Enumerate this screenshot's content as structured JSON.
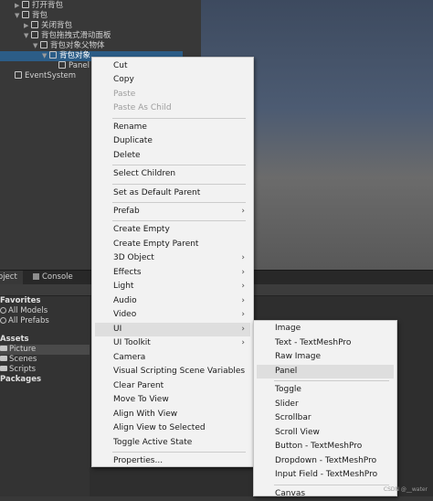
{
  "hierarchy": {
    "items": [
      {
        "label": "打开背包"
      },
      {
        "label": "背包"
      },
      {
        "label": "关闭背包"
      },
      {
        "label": "背包拖拽式滑动面板"
      },
      {
        "label": "背包对象父物体"
      },
      {
        "label": "背包对象"
      },
      {
        "label": "Panel"
      },
      {
        "label": "EventSystem"
      }
    ]
  },
  "tabs": {
    "project": "oject",
    "console": "Console"
  },
  "project": {
    "favorites": "Favorites",
    "all_models": "All Models",
    "all_prefabs": "All Prefabs",
    "assets": "Assets",
    "picture": "Picture",
    "scenes": "Scenes",
    "scripts": "Scripts",
    "packages": "Packages"
  },
  "context_menu": {
    "items": [
      {
        "label": "Cut"
      },
      {
        "label": "Copy"
      },
      {
        "label": "Paste"
      },
      {
        "label": "Paste As Child"
      },
      {
        "label": "Rename"
      },
      {
        "label": "Duplicate"
      },
      {
        "label": "Delete"
      },
      {
        "label": "Select Children"
      },
      {
        "label": "Set as Default Parent"
      },
      {
        "label": "Prefab"
      },
      {
        "label": "Create Empty"
      },
      {
        "label": "Create Empty Parent"
      },
      {
        "label": "3D Object"
      },
      {
        "label": "Effects"
      },
      {
        "label": "Light"
      },
      {
        "label": "Audio"
      },
      {
        "label": "Video"
      },
      {
        "label": "UI"
      },
      {
        "label": "UI Toolkit"
      },
      {
        "label": "Camera"
      },
      {
        "label": "Visual Scripting Scene Variables"
      },
      {
        "label": "Clear Parent"
      },
      {
        "label": "Move To View"
      },
      {
        "label": "Align With View"
      },
      {
        "label": "Align View to Selected"
      },
      {
        "label": "Toggle Active State"
      },
      {
        "label": "Properties..."
      }
    ]
  },
  "ui_submenu": {
    "items": [
      {
        "label": "Image"
      },
      {
        "label": "Text - TextMeshPro"
      },
      {
        "label": "Raw Image"
      },
      {
        "label": "Panel"
      },
      {
        "label": "Toggle"
      },
      {
        "label": "Slider"
      },
      {
        "label": "Scrollbar"
      },
      {
        "label": "Scroll View"
      },
      {
        "label": "Button - TextMeshPro"
      },
      {
        "label": "Dropdown - TextMeshPro"
      },
      {
        "label": "Input Field - TextMeshPro"
      },
      {
        "label": "Canvas"
      }
    ]
  },
  "watermark": "CSDN @__water",
  "icons": {
    "submenu_arrow": "chevron-right-icon",
    "gameobject": "cube-icon",
    "folder": "folder-icon",
    "search": "search-icon"
  },
  "colors": {
    "selection": "#2c5d87",
    "menu_bg": "#f2f2f2",
    "menu_highlight": "#dedede",
    "editor_bg": "#383838"
  }
}
